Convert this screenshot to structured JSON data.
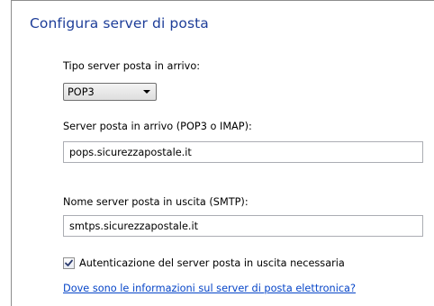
{
  "title": "Configura server di posta",
  "incoming_type": {
    "label": "Tipo server posta in arrivo:",
    "selected": "POP3"
  },
  "incoming_server": {
    "label": "Server posta in arrivo (POP3 o IMAP):",
    "value": "pops.sicurezzapostale.it"
  },
  "outgoing_server": {
    "label": "Nome server posta in uscita (SMTP):",
    "value": "smtps.sicurezzapostale.it"
  },
  "auth_checkbox": {
    "label": "Autenticazione del server posta in uscita necessaria",
    "checked": true
  },
  "help_link": "Dove sono le informazioni sul server di posta elettronica?",
  "colors": {
    "title": "#1e3e99",
    "link": "#0645c8",
    "border": "#8d8d8d"
  },
  "icons": [
    "chevron-down-icon",
    "checkmark-icon"
  ]
}
